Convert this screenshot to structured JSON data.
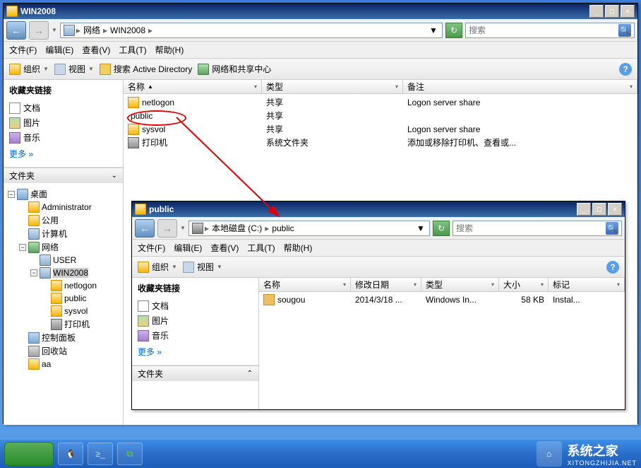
{
  "main_window": {
    "title": "WIN2008",
    "breadcrumb": {
      "seg1": "网络",
      "seg2": "WIN2008"
    },
    "search_placeholder": "搜索",
    "menubar": {
      "file": "文件(F)",
      "edit": "编辑(E)",
      "view": "查看(V)",
      "tools": "工具(T)",
      "help": "帮助(H)"
    },
    "toolbar": {
      "organize": "组织",
      "views": "视图",
      "search_ad": "搜索 Active Directory",
      "net_share": "网络和共享中心"
    },
    "favorites": {
      "title": "收藏夹链接",
      "docs": "文档",
      "pics": "图片",
      "music": "音乐",
      "more": "更多 »"
    },
    "folders_label": "文件夹",
    "tree": {
      "desktop": "桌面",
      "admin": "Administrator",
      "public_user": "公用",
      "computer": "计算机",
      "network": "网络",
      "user": "USER",
      "win2008": "WIN2008",
      "netlogon": "netlogon",
      "public": "public",
      "sysvol": "sysvol",
      "printers": "打印机",
      "control": "控制面板",
      "recycle": "回收站",
      "aa": "aa"
    },
    "columns": {
      "name": "名称",
      "type": "类型",
      "remarks": "备注"
    },
    "rows": [
      {
        "name": "netlogon",
        "type": "共享",
        "remarks": "Logon server share",
        "icon": "share"
      },
      {
        "name": "public",
        "type": "共享",
        "remarks": "",
        "icon": "share"
      },
      {
        "name": "sysvol",
        "type": "共享",
        "remarks": "Logon server share",
        "icon": "share"
      },
      {
        "name": "打印机",
        "type": "系统文件夹",
        "remarks": "添加或移除打印机、查看或...",
        "icon": "printer"
      }
    ]
  },
  "sub_window": {
    "title": "public",
    "breadcrumb": {
      "seg1": "本地磁盘 (C:)",
      "seg2": "public"
    },
    "search_placeholder": "搜索",
    "menubar": {
      "file": "文件(F)",
      "edit": "编辑(E)",
      "view": "查看(V)",
      "tools": "工具(T)",
      "help": "帮助(H)"
    },
    "toolbar": {
      "organize": "组织",
      "views": "视图"
    },
    "favorites": {
      "title": "收藏夹链接",
      "docs": "文档",
      "pics": "图片",
      "music": "音乐",
      "more": "更多 »"
    },
    "folders_label": "文件夹",
    "columns": {
      "name": "名称",
      "date": "修改日期",
      "type": "类型",
      "size": "大小",
      "tags": "标记"
    },
    "rows": [
      {
        "name": "sougou",
        "date": "2014/3/18 ...",
        "type": "Windows In...",
        "size": "58 KB",
        "tags": "Instal..."
      }
    ]
  },
  "brand": {
    "name": "系统之家",
    "sub": "XITONGZHIJIA.NET"
  }
}
